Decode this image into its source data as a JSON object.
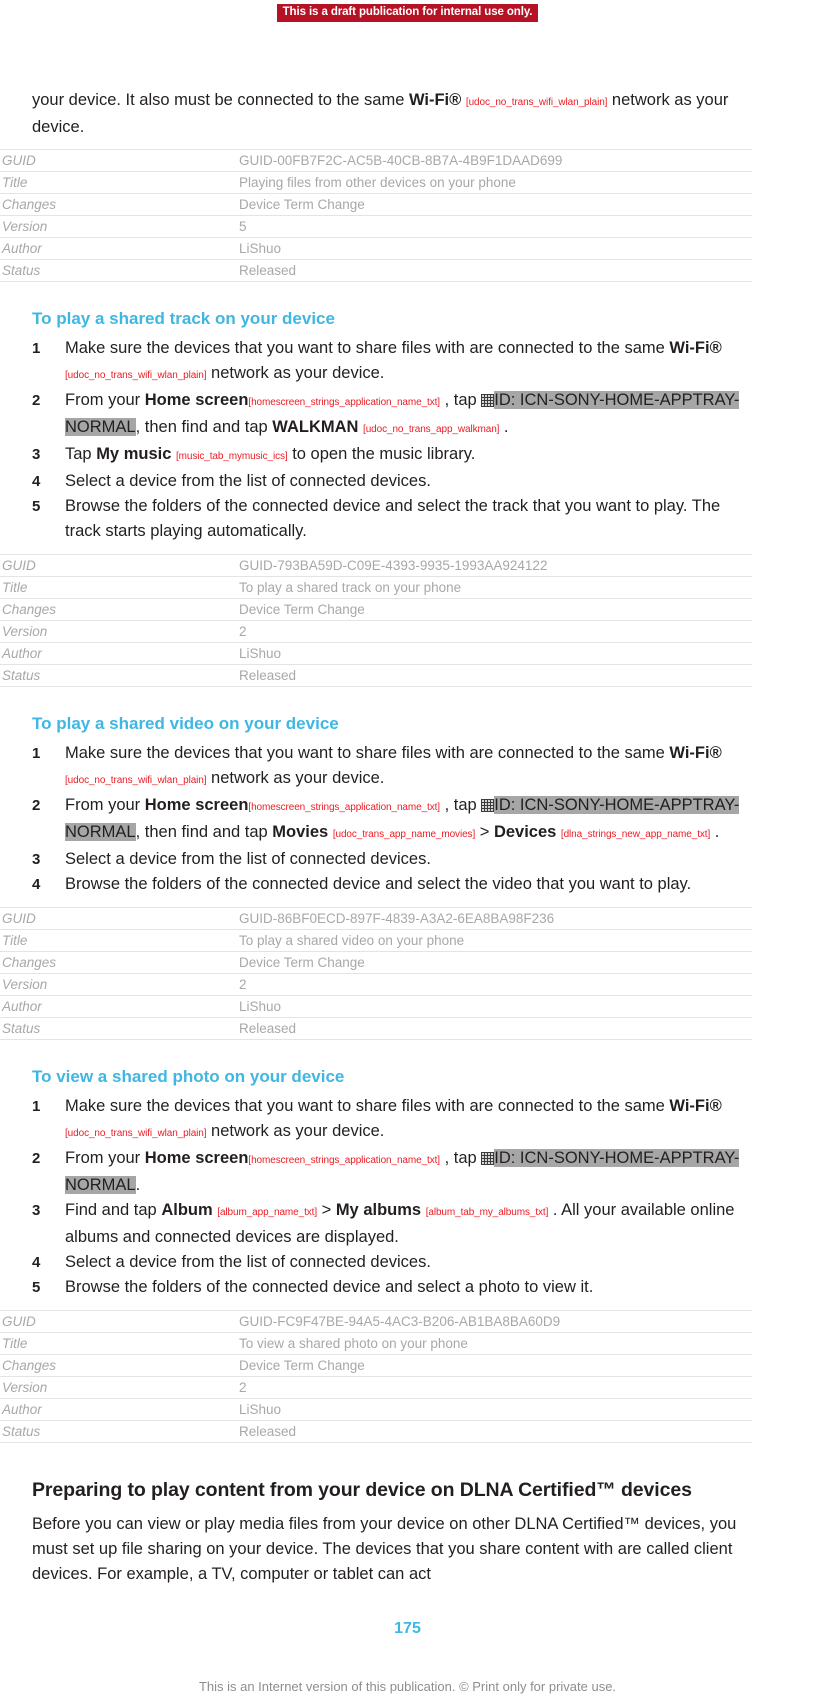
{
  "banner": {
    "text": "This is a draft publication for internal use only.",
    "bg_color": "#b51225",
    "text_color": "#ffffff"
  },
  "colors": {
    "heading_accent": "#3fb7e2",
    "tag_red": "#ed1c24",
    "highlight_gray": "#a6a6a6",
    "meta_gray": "#a8a8a8",
    "body_black": "#231f20"
  },
  "intro_paragraph": {
    "part1": "your device. It also must be connected to the same ",
    "bold1": "Wi-Fi®",
    "tag1": "[udoc_no_trans_wifi_wlan_plain]",
    "part2": " network as your device."
  },
  "meta_labels": {
    "guid": "GUID",
    "title": "Title",
    "changes": "Changes",
    "version": "Version",
    "author": "Author",
    "status": "Status"
  },
  "meta_tables": [
    {
      "guid": "GUID-00FB7F2C-AC5B-40CB-8B7A-4B9F1DAAD699",
      "title": "Playing files from other devices on your phone",
      "changes": "Device Term Change",
      "version": "5",
      "author": "LiShuo",
      "status": "Released"
    },
    {
      "guid": "GUID-793BA59D-C09E-4393-9935-1993AA924122",
      "title": "To play a shared track on your phone",
      "changes": "Device Term Change",
      "version": "2",
      "author": "LiShuo",
      "status": "Released"
    },
    {
      "guid": "GUID-86BF0ECD-897F-4839-A3A2-6EA8BA98F236",
      "title": "To play a shared video on your phone",
      "changes": "Device Term Change",
      "version": "2",
      "author": "LiShuo",
      "status": "Released"
    },
    {
      "guid": "GUID-FC9F47BE-94A5-4AC3-B206-AB1BA8BA60D9",
      "title": "To view a shared photo on your phone",
      "changes": "Device Term Change",
      "version": "2",
      "author": "LiShuo",
      "status": "Released"
    }
  ],
  "sections": {
    "track": {
      "heading": "To play a shared track on your device",
      "step1": {
        "part1": "Make sure the devices that you want to share files with are connected to the same ",
        "bold1": "Wi-Fi®",
        "tag1": "[udoc_no_trans_wifi_wlan_plain]",
        "part2": " network as your device."
      },
      "step2": {
        "part1": "From your ",
        "bold1": "Home screen",
        "tag1": "[homescreen_strings_application_name_txt]",
        "part2": " , tap ",
        "highlight": "ID: ICN-SONY-HOME-APPTRAY-NORMAL",
        "part3": ", then find and tap ",
        "bold2": "WALKMAN",
        "tag2": "[udoc_no_trans_app_walkman]",
        "part4": " ."
      },
      "step3": {
        "part1": "Tap ",
        "bold1": "My music",
        "tag1": "[music_tab_mymusic_ics]",
        "part2": " to open the music library."
      },
      "step4": "Select a device from the list of connected devices.",
      "step5": "Browse the folders of the connected device and select the track that you want to play. The track starts playing automatically."
    },
    "video": {
      "heading": "To play a shared video on your device",
      "step1": {
        "part1": "Make sure the devices that you want to share files with are connected to the same ",
        "bold1": "Wi-Fi®",
        "tag1": "[udoc_no_trans_wifi_wlan_plain]",
        "part2": " network as your device."
      },
      "step2": {
        "part1": "From your ",
        "bold1": "Home screen",
        "tag1": "[homescreen_strings_application_name_txt]",
        "part2": " , tap ",
        "highlight": "ID: ICN-SONY-HOME-APPTRAY-NORMAL",
        "part3": ", then find and tap ",
        "bold2": "Movies",
        "tag2": "[udoc_trans_app_name_movies]",
        "part4": " > ",
        "bold3": "Devices",
        "tag3": "[dlna_strings_new_app_name_txt]",
        "part5": " ."
      },
      "step3": "Select a device from the list of connected devices.",
      "step4": "Browse the folders of the connected device and select the video that you want to play."
    },
    "photo": {
      "heading": "To view a shared photo on your device",
      "step1": {
        "part1": "Make sure the devices that you want to share files with are connected to the same ",
        "bold1": "Wi-Fi®",
        "tag1": "[udoc_no_trans_wifi_wlan_plain]",
        "part2": " network as your device."
      },
      "step2": {
        "part1": "From your ",
        "bold1": "Home screen",
        "tag1": "[homescreen_strings_application_name_txt]",
        "part2": " , tap ",
        "highlight": "ID: ICN-SONY-HOME-APPTRAY-NORMAL",
        "part3": "."
      },
      "step3": {
        "part1": "Find and tap ",
        "bold1": "Album",
        "tag1": "[album_app_name_txt]",
        "part2": " > ",
        "bold2": "My albums",
        "tag2": "[album_tab_my_albums_txt]",
        "part3": " . All your available online albums and connected devices are displayed."
      },
      "step4": "Select a device from the list of connected devices.",
      "step5": "Browse the folders of the connected device and select a photo to view it."
    }
  },
  "final_section": {
    "heading": "Preparing to play content from your device on DLNA Certified™ devices",
    "paragraph": "Before you can view or play media files from your device on other DLNA Certified™ devices, you must set up file sharing on your device. The devices that you share content with are called client devices. For example, a TV, computer or tablet can act"
  },
  "footer": {
    "page_number": "175",
    "note": "This is an Internet version of this publication. © Print only for private use."
  },
  "icons": {
    "apptray": "apptray-grid-icon"
  }
}
